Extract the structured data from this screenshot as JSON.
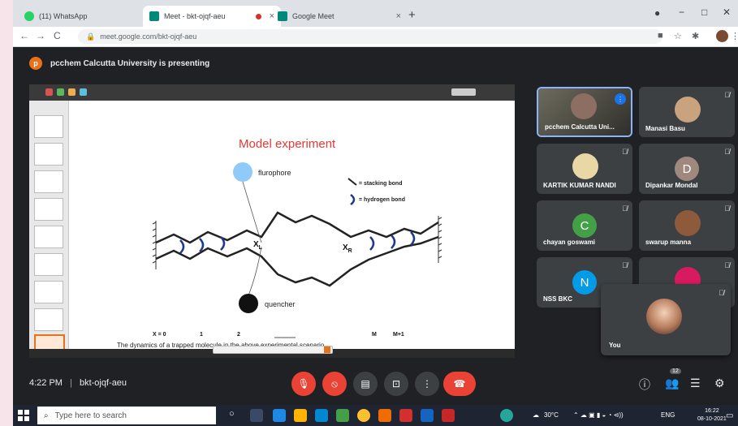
{
  "browser": {
    "tabs": [
      {
        "label": "(11) WhatsApp",
        "close": "×",
        "favicon_color": "#25d366",
        "active": false
      },
      {
        "label": "Meet - bkt-ojqf-aeu",
        "close": "×",
        "favicon_color": "#00897b",
        "active": true
      },
      {
        "label": "Google Meet",
        "close": "×",
        "favicon_color": "#00897b",
        "active": false
      }
    ],
    "new_tab": "+",
    "url": "meet.google.com/bkt-ojqf-aeu",
    "window_controls": {
      "minimize": "−",
      "maximize": "□",
      "close": "✕"
    }
  },
  "meet": {
    "presenting_initial": "p",
    "presenting_text": "pcchem Calcutta University is presenting",
    "slide": {
      "title": "Model experiment",
      "flurophore": "flurophore",
      "quencher": "quencher",
      "legend_stacking": "= stacking bond",
      "legend_hydrogen": "= hydrogen bond",
      "xl": "X",
      "xl_sub": "L",
      "xr": "X",
      "xr_sub": "R",
      "axis_labels": [
        "X = 0",
        "1",
        "2",
        "M",
        "M+1"
      ],
      "footer_text": "The dynamics of a trapped molecule in the above experimental scenario"
    },
    "participants": [
      {
        "name": "pcchem Calcutta Uni...",
        "type": "video",
        "speaking": true
      },
      {
        "name": "Manasi Basu",
        "type": "photo",
        "muted": true
      },
      {
        "name": "KARTIK KUMAR NANDI",
        "type": "photo",
        "muted": true
      },
      {
        "name": "Dipankar Mondal",
        "type": "letter",
        "letter": "D",
        "color": "#a1887f",
        "muted": true
      },
      {
        "name": "chayan goswami",
        "type": "letter",
        "letter": "C",
        "color": "#43a047",
        "muted": true
      },
      {
        "name": "swarup manna",
        "type": "photo",
        "muted": true
      },
      {
        "name": "NSS BKC",
        "type": "letter",
        "letter": "N",
        "color": "#039be5",
        "muted": true
      },
      {
        "name": "",
        "type": "photo",
        "muted": true
      }
    ],
    "self_name": "You",
    "time": "4:22 PM",
    "separator": "|",
    "meeting_code": "bkt-ojqf-aeu",
    "participant_count": "12"
  },
  "taskbar": {
    "search_placeholder": "Type here to search",
    "temperature": "30°C",
    "language": "ENG",
    "time": "16:22",
    "date": "08-10-2021"
  }
}
